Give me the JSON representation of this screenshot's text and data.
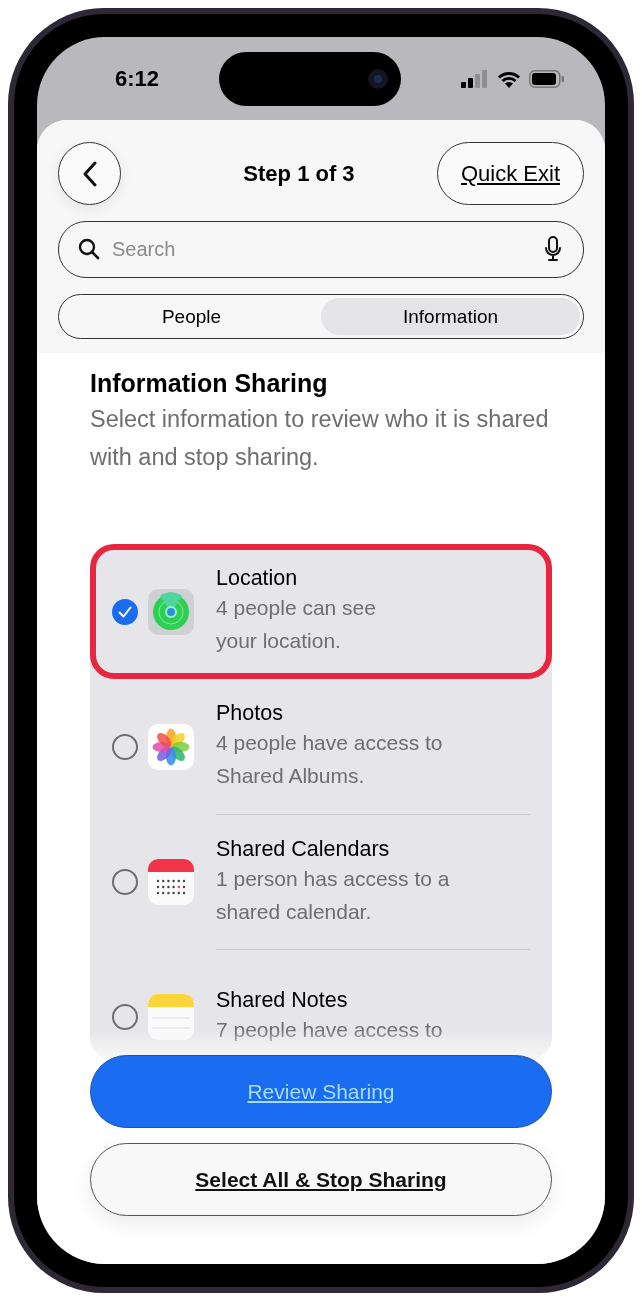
{
  "status_bar": {
    "time": "6:12"
  },
  "header": {
    "title": "Step 1 of 3",
    "quick_exit": "Quick Exit"
  },
  "search": {
    "placeholder": "Search"
  },
  "tabs": [
    {
      "label": "People",
      "selected": false
    },
    {
      "label": "Information",
      "selected": true
    }
  ],
  "section": {
    "title": "Information Sharing",
    "subtitle": "Select information to review who it is shared with and stop sharing."
  },
  "items": [
    {
      "kind": "location",
      "title": "Location",
      "subtitle": "4 people can see\nyour location.",
      "selected": true,
      "highlighted": true
    },
    {
      "kind": "photos",
      "title": "Photos",
      "subtitle": "4 people have access to\nShared Albums.",
      "selected": false,
      "highlighted": false
    },
    {
      "kind": "calendar",
      "title": "Shared Calendars",
      "subtitle": "1 person has access to a\nshared calendar.",
      "selected": false,
      "highlighted": false
    },
    {
      "kind": "notes",
      "title": "Shared Notes",
      "subtitle": "7 people have access to",
      "selected": false,
      "highlighted": false
    }
  ],
  "buttons": [
    {
      "kind": "primary",
      "label": "Review Sharing"
    },
    {
      "kind": "secondary",
      "label": "Select All & Stop Sharing"
    }
  ]
}
